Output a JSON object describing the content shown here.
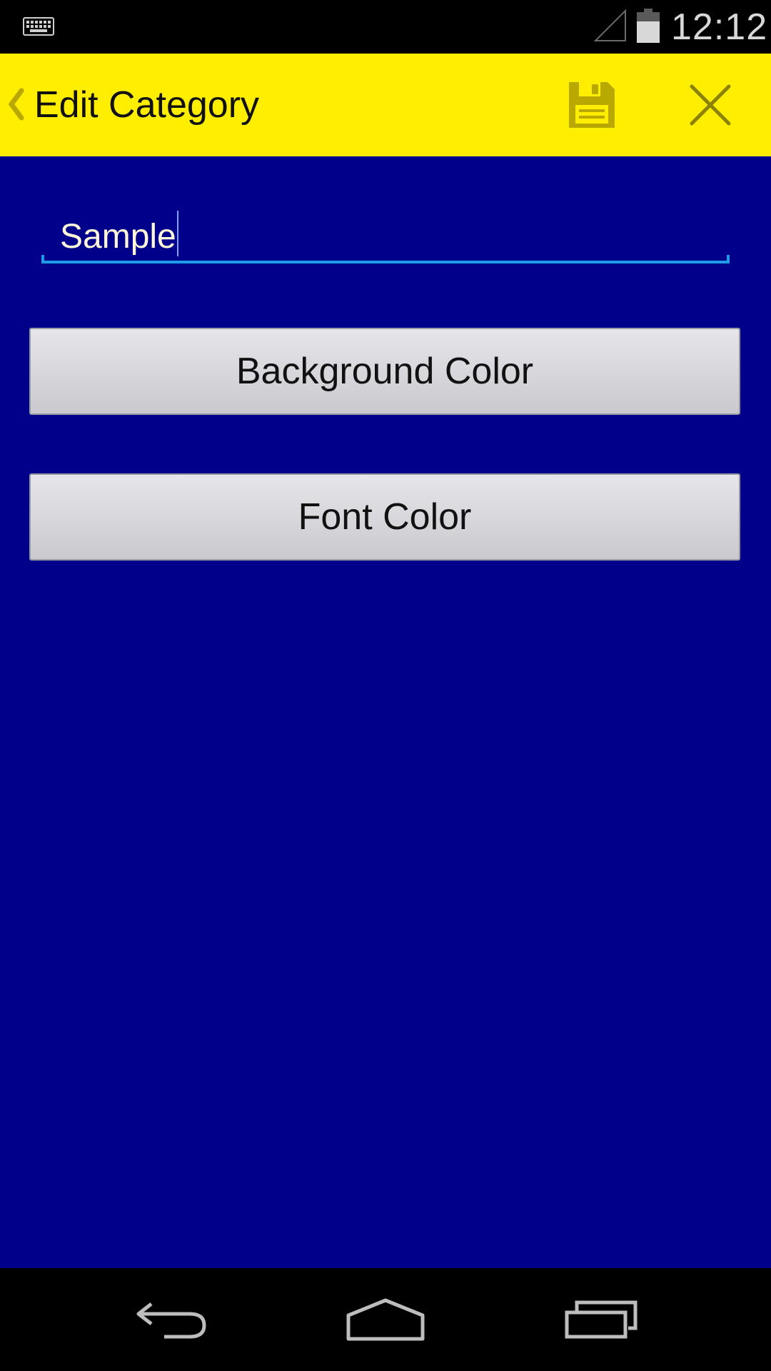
{
  "status_bar": {
    "time": "12:12",
    "keyboard_icon": "keyboard-icon",
    "signal_icon": "signal-icon",
    "battery_icon": "battery-icon"
  },
  "action_bar": {
    "title": "Edit Category",
    "back_icon": "chevron-left-icon",
    "save_icon": "save-icon",
    "close_icon": "close-icon",
    "background_color": "#ffee00"
  },
  "form": {
    "name_value": "Sample",
    "background_button_label": "Background Color",
    "font_button_label": "Font Color",
    "content_background": "#00008b",
    "text_color": "#fff7d8",
    "accent": "#1e9be6"
  },
  "nav_bar": {
    "back_icon": "back-icon",
    "home_icon": "home-icon",
    "recents_icon": "recents-icon"
  }
}
